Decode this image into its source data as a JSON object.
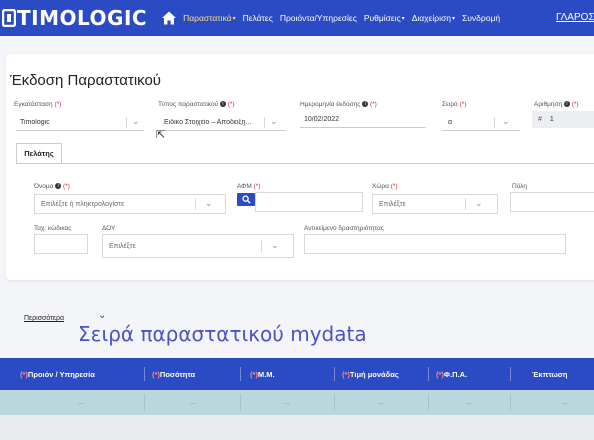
{
  "navbar": {
    "logo_text": "TIMOLOGIC",
    "items": [
      {
        "label": "Παραστατικά",
        "caret": "▾"
      },
      {
        "label": "Πελάτες",
        "caret": ""
      },
      {
        "label": "Προιόντα/Υπηρεσίες",
        "caret": ""
      },
      {
        "label": "Ρυθμίσεις",
        "caret": "▾"
      },
      {
        "label": "Διαχείριση",
        "caret": "▾"
      },
      {
        "label": "Συνδρομή",
        "caret": ""
      }
    ],
    "user_label": "ΓΛΑΡΟΣ",
    "active_color": "#ffe07a",
    "bar_color": "#2b4bc4"
  },
  "page": {
    "title": "Έκδοση Παραστατικού"
  },
  "form": {
    "installation": {
      "label": "Εγκατάσταση",
      "req": "(*)",
      "value": "Timologic"
    },
    "doc_type": {
      "label": "Τύπος παραστατικού",
      "req": "(*)",
      "value": "Ειδικό Στοιχείο – Αποδειξη..."
    },
    "issue_date": {
      "label": "Ημερομηνία έκδοσης",
      "req": "(*)",
      "value": "10/02/2022"
    },
    "series": {
      "label": "Σειρά",
      "req": "(*)",
      "value": "α"
    },
    "number": {
      "label": "Αριθμηση",
      "req": "(*)",
      "prefix": "#",
      "value": "1"
    }
  },
  "tabs": [
    {
      "label": "Πελάτης"
    }
  ],
  "customer": {
    "name": {
      "label": "Όνομα",
      "req": "(*)",
      "placeholder": "Επιλέξτε ή πληκτρολογίστε"
    },
    "afm": {
      "label": "ΑΦΜ",
      "req": "(*)"
    },
    "country": {
      "label": "Χώρα",
      "req": "(*)",
      "placeholder": "Επιλέξτε"
    },
    "city": {
      "label": "Πόλη"
    },
    "postal": {
      "label": "Ταχ. κώδικας"
    },
    "doy": {
      "label": "ΔΟΥ",
      "placeholder": "Επιλέξτε"
    },
    "activity": {
      "label": "Αντικείμενο δραστηριότητας"
    }
  },
  "more": {
    "label": "Περισσότερα",
    "chev": "⌄"
  },
  "overlay_caption": "Σειρά παραστατικού mydata",
  "table": {
    "columns": [
      {
        "label": "Προιόν / Υπηρεσία",
        "star": "(*)"
      },
      {
        "label": "Ποσότητα",
        "star": "(*)"
      },
      {
        "label": "Μ.Μ.",
        "star": "(*)"
      },
      {
        "label": "Τιμή μονάδας",
        "star": "(*)"
      },
      {
        "label": "Φ.Π.Α.",
        "star": "(*)"
      },
      {
        "label": "Έκπτωση",
        "star": ""
      }
    ],
    "row_cells": [
      "...",
      "...",
      "...",
      "...",
      "...",
      "..."
    ],
    "header_color": "#2b4bc4",
    "row_color": "#b9d7dd"
  }
}
